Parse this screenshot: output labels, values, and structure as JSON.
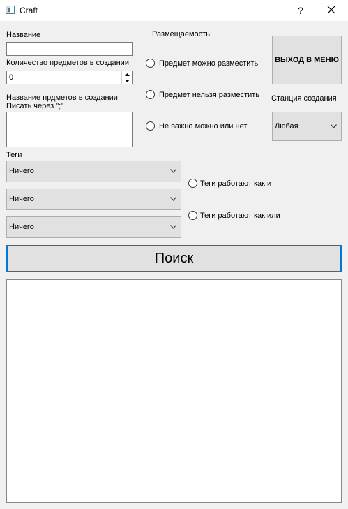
{
  "window": {
    "title": "Craft",
    "help_label": "?"
  },
  "name_field": {
    "label": "Название",
    "value": ""
  },
  "quantity_field": {
    "label": "Количество предметов в создании",
    "value": "0"
  },
  "items_field": {
    "label_line1": "Название прдметов в создании",
    "label_line2": "Писать через \";\"",
    "value": ""
  },
  "placement": {
    "label": "Размещаемость",
    "options": [
      "Предмет можно разместить",
      "Предмет нельзя разместить",
      "Не важно можно или нет"
    ]
  },
  "exit_button": {
    "label": "ВЫХОД В МЕНЮ"
  },
  "station": {
    "label": "Станция создания",
    "selected": "Любая"
  },
  "tags": {
    "label": "Теги",
    "selects": [
      "Ничего",
      "Ничего",
      "Ничего"
    ],
    "mode_options": [
      "Теги работают как и",
      "Теги работают как или"
    ]
  },
  "search_button": {
    "label": "Поиск"
  },
  "icons": {
    "app": "app-window-icon",
    "close": "close-icon",
    "dropdown": "chevron-down-icon",
    "spin_up": "triangle-up-icon",
    "spin_down": "triangle-down-icon"
  },
  "colors": {
    "accent": "#0078d7",
    "background": "#f0f0f0",
    "button": "#e1e1e1"
  }
}
